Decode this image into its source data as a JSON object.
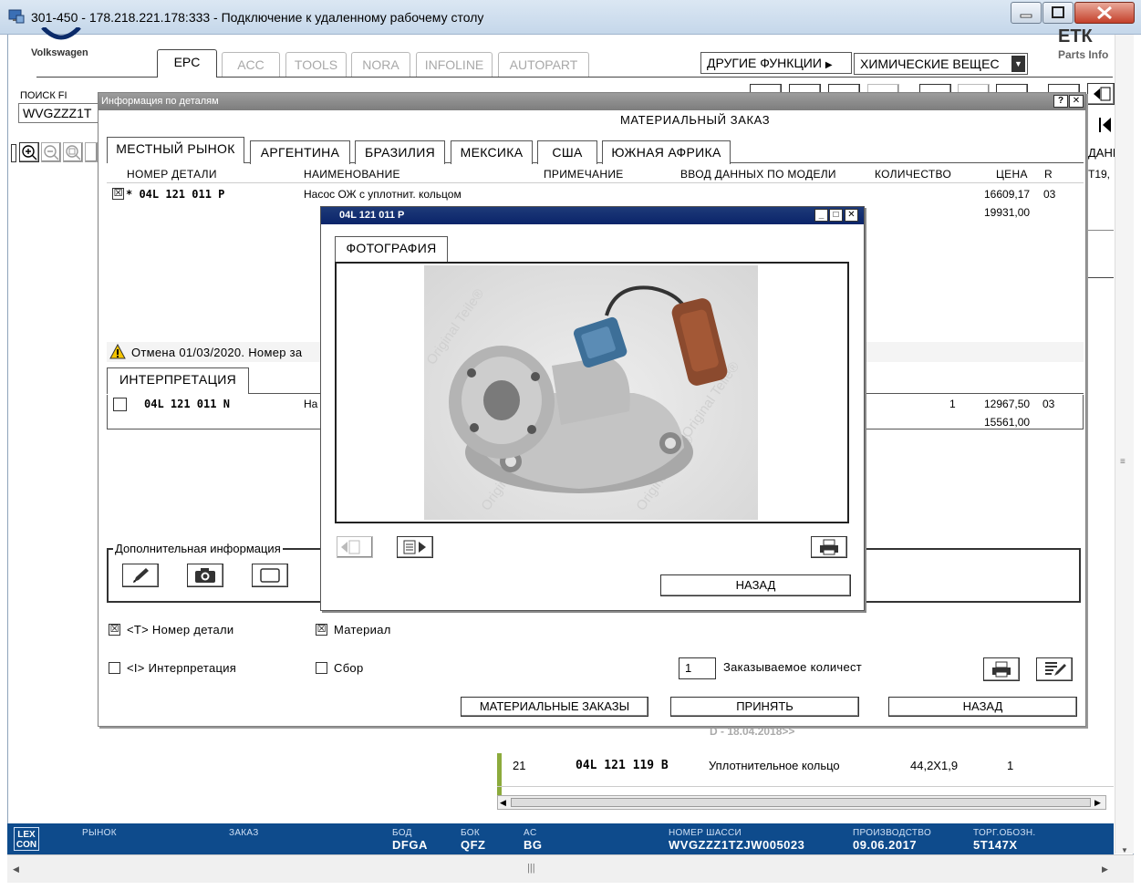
{
  "window": {
    "title": "301-450 - 178.218.221.178:333 - Подключение к удаленному рабочему столу"
  },
  "app": {
    "brand": "Volkswagen",
    "top_tabs": [
      "EPC",
      "ACC",
      "TOOLS",
      "NORA",
      "INFOLINE",
      "AUTOPART"
    ],
    "active_tab": "EPC",
    "other_functions_label": "ДРУГИЕ ФУНКЦИИ",
    "function_select_value": "ХИМИЧЕСКИЕ ВЕЩЕС",
    "search_label": "ПОИСК FI",
    "search_value": "WVGZZZ1T"
  },
  "main_dialog": {
    "title": "Информация по деталям",
    "heading": "МАТЕРИАЛЬНЫЙ ЗАКАЗ",
    "market_tabs": [
      "МЕСТНЫЙ РЫНОК",
      "АРГЕНТИНА",
      "БРАЗИЛИЯ",
      "МЕКСИКА",
      "США",
      "ЮЖНАЯ АФРИКА"
    ],
    "columns": [
      "НОМЕР ДЕТАЛИ",
      "НАИМЕНОВАНИЕ",
      "ПРИМЕЧАНИЕ",
      "ВВОД ДАННЫХ ПО МОДЕЛИ",
      "КОЛИЧЕСТВО",
      "ЦЕНА",
      "R"
    ],
    "part_row": {
      "checked": "☒",
      "part_no": "* 04L 121 011 P",
      "name": "Насос ОЖ с уплотнит. кольцом",
      "price1": "16609,17",
      "price2": "19931,00",
      "r": "03"
    },
    "warning_text": "Отмена 01/03/2020. Номер за",
    "interpretation_tab": "ИНТЕРПРЕТАЦИЯ",
    "interp_row": {
      "part_no": "04L 121 011 N",
      "name": "На",
      "qty": "1",
      "price1": "12967,50",
      "price2": "15561,00",
      "r": "03"
    },
    "additional_info_label": "Дополнительная информация",
    "check_part_no": "<T> Номер детали",
    "check_material": "Материал",
    "check_interpretation": "<I> Интерпретация",
    "check_assembly": "Сбор",
    "order_qty_value": "1",
    "order_qty_label": "Заказываемое количест",
    "btn_material_orders": "МАТЕРИАЛЬНЫЕ ЗАКАЗЫ",
    "btn_accept": "ПРИНЯТЬ",
    "btn_back": "НАЗАД"
  },
  "photo_popup": {
    "title": "04L 121 011 P",
    "tab": "ФОТОГРАФИЯ",
    "watermark": "Original Teile®",
    "btn_back": "НАЗАД"
  },
  "background": {
    "date_note": "D - 18.04.2018>>",
    "row21": {
      "pos": "21",
      "part_no": "04L 121 119 B",
      "name": "Уплотнительное кольцо",
      "size": "44,2X1,9",
      "qty": "1"
    }
  },
  "status_bar": {
    "logo": "LEX\nCON",
    "market_label": "РЫНОК",
    "order_label": "ЗАКАЗ",
    "bod_label": "БОД",
    "bod_value": "DFGA",
    "bok_label": "БОК",
    "bok_value": "QFZ",
    "ac_label": "AC",
    "ac_value": "BG",
    "chassis_label": "НОМЕР ШАССИ",
    "chassis_value": "WVGZZZ1TZJW005023",
    "production_label": "ПРОИЗВОДСТВО",
    "production_value": "09.06.2017",
    "trade_label": "ТОРГ.ОБОЗН.",
    "trade_value": "5T147X"
  },
  "colors": {
    "titlebar": "#c5d7ea",
    "status_bar": "#0e4b8c",
    "popup_caption": "#0a246a",
    "warning": "#f5c400"
  }
}
